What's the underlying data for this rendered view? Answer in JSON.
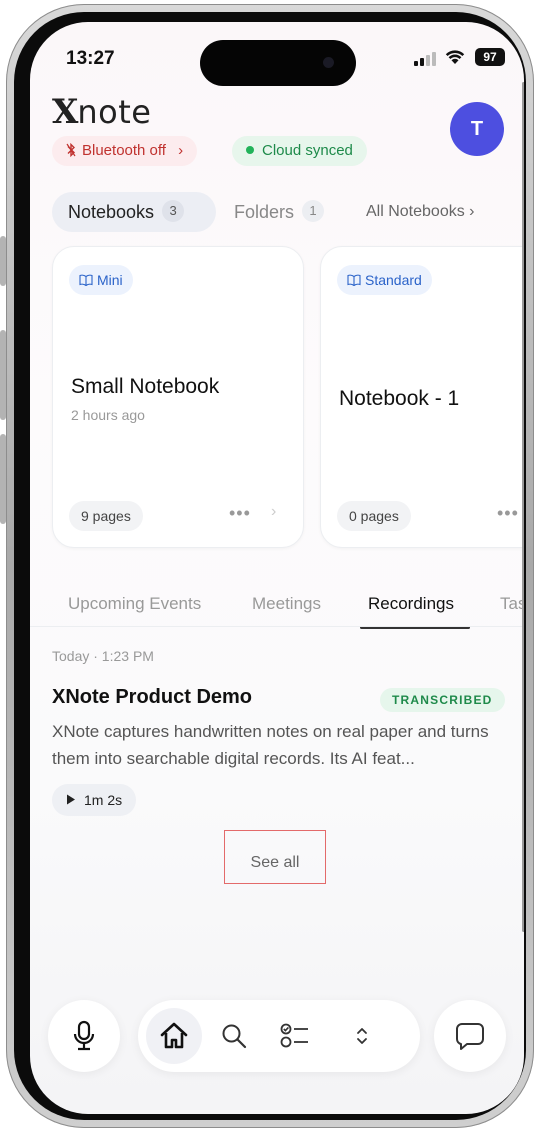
{
  "status_bar": {
    "time": "13:27",
    "battery": "97"
  },
  "header": {
    "app_name_prefix": "X",
    "app_name_suffix": "note",
    "avatar_initial": "T"
  },
  "status_pills": {
    "bluetooth": "Bluetooth off",
    "bluetooth_chevron": "›",
    "cloud": "Cloud synced"
  },
  "notebook_tabs": {
    "notebooks_label": "Notebooks",
    "notebooks_count": "3",
    "folders_label": "Folders",
    "folders_count": "1",
    "all_link": "All Notebooks ›"
  },
  "notebooks": [
    {
      "tag": "Mini",
      "title": "Small Notebook",
      "subtitle": "2 hours ago",
      "pages": "9 pages"
    },
    {
      "tag": "Standard",
      "title": "Notebook - 1",
      "pages": "0 pages"
    }
  ],
  "more_glyph": "•••",
  "chevron_glyph": "›",
  "section_tabs": [
    "Upcoming Events",
    "Meetings",
    "Recordings",
    "Tas"
  ],
  "recording": {
    "time": "Today · 1:23 PM",
    "title": "XNote Product Demo",
    "status": "TRANSCRIBED",
    "description": "XNote captures handwritten notes on real paper and turns them into searchable digital records. Its AI feat...",
    "duration": "1m 2s"
  },
  "see_all": "See all",
  "colors": {
    "accent": "#4d4fe0",
    "bluetooth": "#c0322f",
    "synced": "#1e8a4a",
    "tag": "#2b63c9"
  },
  "bottom_nav": {
    "mic": "mic-icon",
    "home": "home-icon",
    "search": "search-icon",
    "tasks": "checklist-icon",
    "expand": "chevron-updown-icon",
    "chat": "chat-icon"
  }
}
